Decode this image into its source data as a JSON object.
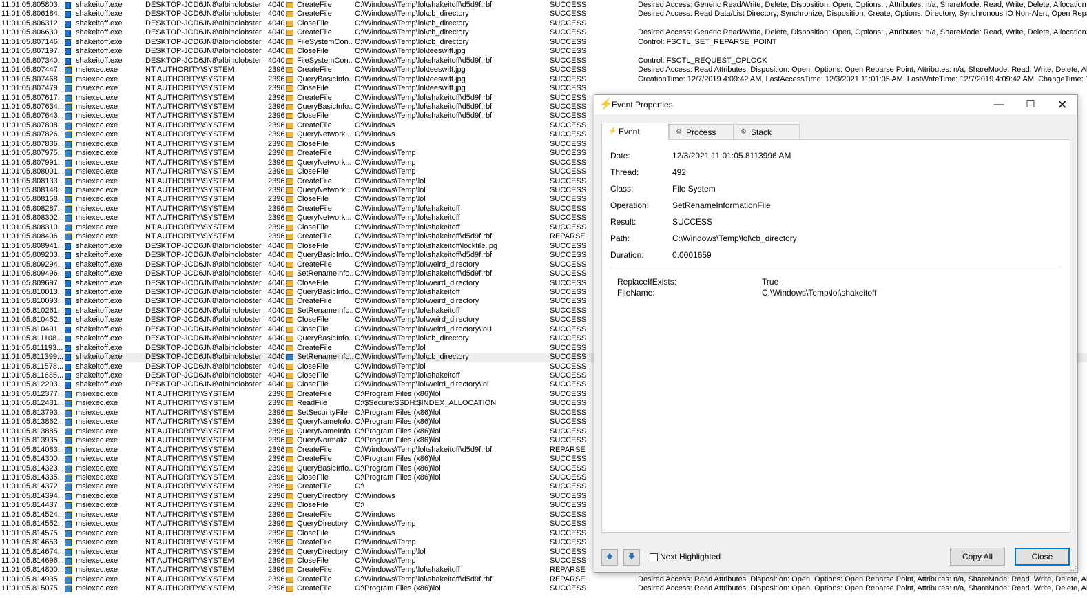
{
  "log_rows": [
    {
      "time": "11:01:05.805803...",
      "process": "shakeitoff.exe",
      "user": "DESKTOP-JCD6JN8\\albinolobster",
      "pid": "4040",
      "operation": "CreateFile",
      "path": "C:\\Windows\\Temp\\lol\\shakeitoff\\d5d9f.rbf",
      "result": "SUCCESS",
      "detail": "Desired Access: Generic Read/Write, Delete, Disposition: Open, Options: , Attributes: n/a, ShareMode: Read, Write, Delete, AllocationSize:"
    },
    {
      "time": "11:01:05.806184...",
      "process": "shakeitoff.exe",
      "user": "DESKTOP-JCD6JN8\\albinolobster",
      "pid": "4040",
      "operation": "CreateFile",
      "path": "C:\\Windows\\Temp\\lol\\cb_directory",
      "result": "SUCCESS",
      "detail": "Desired Access: Read Data/List Directory, Synchronize, Disposition: Create, Options: Directory, Synchronous IO Non-Alert, Open Reparse"
    },
    {
      "time": "11:01:05.806312...",
      "process": "shakeitoff.exe",
      "user": "DESKTOP-JCD6JN8\\albinolobster",
      "pid": "4040",
      "operation": "CloseFile",
      "path": "C:\\Windows\\Temp\\lol\\cb_directory",
      "result": "SUCCESS",
      "detail": ""
    },
    {
      "time": "11:01:05.806630...",
      "process": "shakeitoff.exe",
      "user": "DESKTOP-JCD6JN8\\albinolobster",
      "pid": "4040",
      "operation": "CreateFile",
      "path": "C:\\Windows\\Temp\\lol\\cb_directory",
      "result": "SUCCESS",
      "detail": "Desired Access: Generic Read/Write, Delete, Disposition: Open, Options: , Attributes: n/a, ShareMode: Read, Write, Delete, AllocationS"
    },
    {
      "time": "11:01:05.807146...",
      "process": "shakeitoff.exe",
      "user": "DESKTOP-JCD6JN8\\albinolobster",
      "pid": "4040",
      "operation": "FileSystemCon...",
      "path": "C:\\Windows\\Temp\\lol\\cb_directory",
      "result": "SUCCESS",
      "detail": "Control: FSCTL_SET_REPARSE_POINT"
    },
    {
      "time": "11:01:05.807197...",
      "process": "shakeitoff.exe",
      "user": "DESKTOP-JCD6JN8\\albinolobster",
      "pid": "4040",
      "operation": "CloseFile",
      "path": "C:\\Windows\\Temp\\lol\\teeswift.jpg",
      "result": "SUCCESS",
      "detail": ""
    },
    {
      "time": "11:01:05.807340...",
      "process": "shakeitoff.exe",
      "user": "DESKTOP-JCD6JN8\\albinolobster",
      "pid": "4040",
      "operation": "FileSystemCon...",
      "path": "C:\\Windows\\Temp\\lol\\shakeitoff\\d5d9f.rbf",
      "result": "SUCCESS",
      "detail": "Control: FSCTL_REQUEST_OPLOCK"
    },
    {
      "time": "11:01:05.807447...",
      "process": "msiexec.exe",
      "user": "NT AUTHORITY\\SYSTEM",
      "pid": "2396",
      "operation": "CreateFile",
      "path": "C:\\Windows\\Temp\\lol\\teeswift.jpg",
      "result": "SUCCESS",
      "detail": "Desired Access: Read Attributes, Disposition: Open, Options: Open Reparse Point, Attributes: n/a, ShareMode: Read, Write, Delete, Allo"
    },
    {
      "time": "11:01:05.807468...",
      "process": "msiexec.exe",
      "user": "NT AUTHORITY\\SYSTEM",
      "pid": "2396",
      "operation": "QueryBasicInfo...",
      "path": "C:\\Windows\\Temp\\lol\\teeswift.jpg",
      "result": "SUCCESS",
      "detail": "CreationTime: 12/7/2019 4:09:42 AM, LastAccessTime: 12/3/2021 11:01:05 AM, LastWriteTime: 12/7/2019 4:09:42 AM, ChangeTime: 1:"
    },
    {
      "time": "11:01:05.807479...",
      "process": "msiexec.exe",
      "user": "NT AUTHORITY\\SYSTEM",
      "pid": "2396",
      "operation": "CloseFile",
      "path": "C:\\Windows\\Temp\\lol\\teeswift.jpg",
      "result": "SUCCESS",
      "detail": ""
    },
    {
      "time": "11:01:05.807617...",
      "process": "msiexec.exe",
      "user": "NT AUTHORITY\\SYSTEM",
      "pid": "2396",
      "operation": "CreateFile",
      "path": "C:\\Windows\\Temp\\lol\\shakeitoff\\d5d9f.rbf",
      "result": "SUCCESS",
      "detail": ""
    },
    {
      "time": "11:01:05.807634...",
      "process": "msiexec.exe",
      "user": "NT AUTHORITY\\SYSTEM",
      "pid": "2396",
      "operation": "QueryBasicInfo...",
      "path": "C:\\Windows\\Temp\\lol\\shakeitoff\\d5d9f.rbf",
      "result": "SUCCESS",
      "detail": ""
    },
    {
      "time": "11:01:05.807643...",
      "process": "msiexec.exe",
      "user": "NT AUTHORITY\\SYSTEM",
      "pid": "2396",
      "operation": "CloseFile",
      "path": "C:\\Windows\\Temp\\lol\\shakeitoff\\d5d9f.rbf",
      "result": "SUCCESS",
      "detail": ""
    },
    {
      "time": "11:01:05.807808...",
      "process": "msiexec.exe",
      "user": "NT AUTHORITY\\SYSTEM",
      "pid": "2396",
      "operation": "CreateFile",
      "path": "C:\\Windows",
      "result": "SUCCESS",
      "detail": ""
    },
    {
      "time": "11:01:05.807826...",
      "process": "msiexec.exe",
      "user": "NT AUTHORITY\\SYSTEM",
      "pid": "2396",
      "operation": "QueryNetwork...",
      "path": "C:\\Windows",
      "result": "SUCCESS",
      "detail": ""
    },
    {
      "time": "11:01:05.807836...",
      "process": "msiexec.exe",
      "user": "NT AUTHORITY\\SYSTEM",
      "pid": "2396",
      "operation": "CloseFile",
      "path": "C:\\Windows",
      "result": "SUCCESS",
      "detail": ""
    },
    {
      "time": "11:01:05.807975...",
      "process": "msiexec.exe",
      "user": "NT AUTHORITY\\SYSTEM",
      "pid": "2396",
      "operation": "CreateFile",
      "path": "C:\\Windows\\Temp",
      "result": "SUCCESS",
      "detail": ""
    },
    {
      "time": "11:01:05.807991...",
      "process": "msiexec.exe",
      "user": "NT AUTHORITY\\SYSTEM",
      "pid": "2396",
      "operation": "QueryNetwork...",
      "path": "C:\\Windows\\Temp",
      "result": "SUCCESS",
      "detail": ""
    },
    {
      "time": "11:01:05.808001...",
      "process": "msiexec.exe",
      "user": "NT AUTHORITY\\SYSTEM",
      "pid": "2396",
      "operation": "CloseFile",
      "path": "C:\\Windows\\Temp",
      "result": "SUCCESS",
      "detail": ""
    },
    {
      "time": "11:01:05.808133...",
      "process": "msiexec.exe",
      "user": "NT AUTHORITY\\SYSTEM",
      "pid": "2396",
      "operation": "CreateFile",
      "path": "C:\\Windows\\Temp\\lol",
      "result": "SUCCESS",
      "detail": ""
    },
    {
      "time": "11:01:05.808148...",
      "process": "msiexec.exe",
      "user": "NT AUTHORITY\\SYSTEM",
      "pid": "2396",
      "operation": "QueryNetwork...",
      "path": "C:\\Windows\\Temp\\lol",
      "result": "SUCCESS",
      "detail": ""
    },
    {
      "time": "11:01:05.808158...",
      "process": "msiexec.exe",
      "user": "NT AUTHORITY\\SYSTEM",
      "pid": "2396",
      "operation": "CloseFile",
      "path": "C:\\Windows\\Temp\\lol",
      "result": "SUCCESS",
      "detail": ""
    },
    {
      "time": "11:01:05.808287...",
      "process": "msiexec.exe",
      "user": "NT AUTHORITY\\SYSTEM",
      "pid": "2396",
      "operation": "CreateFile",
      "path": "C:\\Windows\\Temp\\lol\\shakeitoff",
      "result": "SUCCESS",
      "detail": ""
    },
    {
      "time": "11:01:05.808302...",
      "process": "msiexec.exe",
      "user": "NT AUTHORITY\\SYSTEM",
      "pid": "2396",
      "operation": "QueryNetwork...",
      "path": "C:\\Windows\\Temp\\lol\\shakeitoff",
      "result": "SUCCESS",
      "detail": ""
    },
    {
      "time": "11:01:05.808310...",
      "process": "msiexec.exe",
      "user": "NT AUTHORITY\\SYSTEM",
      "pid": "2396",
      "operation": "CloseFile",
      "path": "C:\\Windows\\Temp\\lol\\shakeitoff",
      "result": "SUCCESS",
      "detail": ""
    },
    {
      "time": "11:01:05.808406...",
      "process": "msiexec.exe",
      "user": "NT AUTHORITY\\SYSTEM",
      "pid": "2396",
      "operation": "CreateFile",
      "path": "C:\\Windows\\Temp\\lol\\shakeitoff\\d5d9f.rbf",
      "result": "REPARSE",
      "detail": ""
    },
    {
      "time": "11:01:05.808941...",
      "process": "shakeitoff.exe",
      "user": "DESKTOP-JCD6JN8\\albinolobster",
      "pid": "4040",
      "operation": "CloseFile",
      "path": "C:\\Windows\\Temp\\lol\\shakeitoff\\lockfile.jpg",
      "result": "SUCCESS",
      "detail": ""
    },
    {
      "time": "11:01:05.809203...",
      "process": "shakeitoff.exe",
      "user": "DESKTOP-JCD6JN8\\albinolobster",
      "pid": "4040",
      "operation": "QueryBasicInfo...",
      "path": "C:\\Windows\\Temp\\lol\\shakeitoff\\d5d9f.rbf",
      "result": "SUCCESS",
      "detail": ""
    },
    {
      "time": "11:01:05.809294...",
      "process": "shakeitoff.exe",
      "user": "DESKTOP-JCD6JN8\\albinolobster",
      "pid": "4040",
      "operation": "CreateFile",
      "path": "C:\\Windows\\Temp\\lol\\weird_directory",
      "result": "SUCCESS",
      "detail": ""
    },
    {
      "time": "11:01:05.809496...",
      "process": "shakeitoff.exe",
      "user": "DESKTOP-JCD6JN8\\albinolobster",
      "pid": "4040",
      "operation": "SetRenameInfo...",
      "path": "C:\\Windows\\Temp\\lol\\shakeitoff\\d5d9f.rbf",
      "result": "SUCCESS",
      "detail": ""
    },
    {
      "time": "11:01:05.809697...",
      "process": "shakeitoff.exe",
      "user": "DESKTOP-JCD6JN8\\albinolobster",
      "pid": "4040",
      "operation": "CloseFile",
      "path": "C:\\Windows\\Temp\\lol\\weird_directory",
      "result": "SUCCESS",
      "detail": ""
    },
    {
      "time": "11:01:05.810013...",
      "process": "shakeitoff.exe",
      "user": "DESKTOP-JCD6JN8\\albinolobster",
      "pid": "4040",
      "operation": "QueryBasicInfo...",
      "path": "C:\\Windows\\Temp\\lol\\shakeitoff",
      "result": "SUCCESS",
      "detail": ""
    },
    {
      "time": "11:01:05.810093...",
      "process": "shakeitoff.exe",
      "user": "DESKTOP-JCD6JN8\\albinolobster",
      "pid": "4040",
      "operation": "CreateFile",
      "path": "C:\\Windows\\Temp\\lol\\weird_directory",
      "result": "SUCCESS",
      "detail": ""
    },
    {
      "time": "11:01:05.810261...",
      "process": "shakeitoff.exe",
      "user": "DESKTOP-JCD6JN8\\albinolobster",
      "pid": "4040",
      "operation": "SetRenameInfo...",
      "path": "C:\\Windows\\Temp\\lol\\shakeitoff",
      "result": "SUCCESS",
      "detail": ""
    },
    {
      "time": "11:01:05.810452...",
      "process": "shakeitoff.exe",
      "user": "DESKTOP-JCD6JN8\\albinolobster",
      "pid": "4040",
      "operation": "CloseFile",
      "path": "C:\\Windows\\Temp\\lol\\weird_directory",
      "result": "SUCCESS",
      "detail": ""
    },
    {
      "time": "11:01:05.810491...",
      "process": "shakeitoff.exe",
      "user": "DESKTOP-JCD6JN8\\albinolobster",
      "pid": "4040",
      "operation": "CloseFile",
      "path": "C:\\Windows\\Temp\\lol\\weird_directory\\lol1",
      "result": "SUCCESS",
      "detail": ""
    },
    {
      "time": "11:01:05.811108...",
      "process": "shakeitoff.exe",
      "user": "DESKTOP-JCD6JN8\\albinolobster",
      "pid": "4040",
      "operation": "QueryBasicInfo...",
      "path": "C:\\Windows\\Temp\\lol\\cb_directory",
      "result": "SUCCESS",
      "detail": ""
    },
    {
      "time": "11:01:05.811193...",
      "process": "shakeitoff.exe",
      "user": "DESKTOP-JCD6JN8\\albinolobster",
      "pid": "4040",
      "operation": "CreateFile",
      "path": "C:\\Windows\\Temp\\lol",
      "result": "SUCCESS",
      "detail": ""
    },
    {
      "time": "11:01:05.811399...",
      "process": "shakeitoff.exe",
      "user": "DESKTOP-JCD6JN8\\albinolobster",
      "pid": "4040",
      "operation": "SetRenameInfo...",
      "path": "C:\\Windows\\Temp\\lol\\cb_directory",
      "result": "SUCCESS",
      "detail": "",
      "selected": true
    },
    {
      "time": "11:01:05.811578...",
      "process": "shakeitoff.exe",
      "user": "DESKTOP-JCD6JN8\\albinolobster",
      "pid": "4040",
      "operation": "CloseFile",
      "path": "C:\\Windows\\Temp\\lol",
      "result": "SUCCESS",
      "detail": ""
    },
    {
      "time": "11:01:05.811635...",
      "process": "shakeitoff.exe",
      "user": "DESKTOP-JCD6JN8\\albinolobster",
      "pid": "4040",
      "operation": "CloseFile",
      "path": "C:\\Windows\\Temp\\lol\\shakeitoff",
      "result": "SUCCESS",
      "detail": ""
    },
    {
      "time": "11:01:05.812203...",
      "process": "shakeitoff.exe",
      "user": "DESKTOP-JCD6JN8\\albinolobster",
      "pid": "4040",
      "operation": "CloseFile",
      "path": "C:\\Windows\\Temp\\lol\\weird_directory\\lol",
      "result": "SUCCESS",
      "detail": ""
    },
    {
      "time": "11:01:05.812377...",
      "process": "msiexec.exe",
      "user": "NT AUTHORITY\\SYSTEM",
      "pid": "2396",
      "operation": "CreateFile",
      "path": "C:\\Program Files (x86)\\lol",
      "result": "SUCCESS",
      "detail": ""
    },
    {
      "time": "11:01:05.812431...",
      "process": "msiexec.exe",
      "user": "NT AUTHORITY\\SYSTEM",
      "pid": "2396",
      "operation": "ReadFile",
      "path": "C:\\$Secure:$SDH:$INDEX_ALLOCATION",
      "result": "SUCCESS",
      "detail": ""
    },
    {
      "time": "11:01:05.813793...",
      "process": "msiexec.exe",
      "user": "NT AUTHORITY\\SYSTEM",
      "pid": "2396",
      "operation": "SetSecurityFile",
      "path": "C:\\Program Files (x86)\\lol",
      "result": "SUCCESS",
      "detail": ""
    },
    {
      "time": "11:01:05.813862...",
      "process": "msiexec.exe",
      "user": "NT AUTHORITY\\SYSTEM",
      "pid": "2396",
      "operation": "QueryNameInfo...",
      "path": "C:\\Program Files (x86)\\lol",
      "result": "SUCCESS",
      "detail": ""
    },
    {
      "time": "11:01:05.813885...",
      "process": "msiexec.exe",
      "user": "NT AUTHORITY\\SYSTEM",
      "pid": "2396",
      "operation": "QueryNameInfo...",
      "path": "C:\\Program Files (x86)\\lol",
      "result": "SUCCESS",
      "detail": ""
    },
    {
      "time": "11:01:05.813935...",
      "process": "msiexec.exe",
      "user": "NT AUTHORITY\\SYSTEM",
      "pid": "2396",
      "operation": "QueryNormaliz...",
      "path": "C:\\Program Files (x86)\\lol",
      "result": "SUCCESS",
      "detail": ""
    },
    {
      "time": "11:01:05.814083...",
      "process": "msiexec.exe",
      "user": "NT AUTHORITY\\SYSTEM",
      "pid": "2396",
      "operation": "CreateFile",
      "path": "C:\\Windows\\Temp\\lol\\shakeitoff\\d5d9f.rbf",
      "result": "REPARSE",
      "detail": ""
    },
    {
      "time": "11:01:05.814300...",
      "process": "msiexec.exe",
      "user": "NT AUTHORITY\\SYSTEM",
      "pid": "2396",
      "operation": "CreateFile",
      "path": "C:\\Program Files (x86)\\lol",
      "result": "SUCCESS",
      "detail": ""
    },
    {
      "time": "11:01:05.814323...",
      "process": "msiexec.exe",
      "user": "NT AUTHORITY\\SYSTEM",
      "pid": "2396",
      "operation": "QueryBasicInfo...",
      "path": "C:\\Program Files (x86)\\lol",
      "result": "SUCCESS",
      "detail": ""
    },
    {
      "time": "11:01:05.814335...",
      "process": "msiexec.exe",
      "user": "NT AUTHORITY\\SYSTEM",
      "pid": "2396",
      "operation": "CloseFile",
      "path": "C:\\Program Files (x86)\\lol",
      "result": "SUCCESS",
      "detail": ""
    },
    {
      "time": "11:01:05.814372...",
      "process": "msiexec.exe",
      "user": "NT AUTHORITY\\SYSTEM",
      "pid": "2396",
      "operation": "CreateFile",
      "path": "C:\\",
      "result": "SUCCESS",
      "detail": ""
    },
    {
      "time": "11:01:05.814394...",
      "process": "msiexec.exe",
      "user": "NT AUTHORITY\\SYSTEM",
      "pid": "2396",
      "operation": "QueryDirectory",
      "path": "C:\\Windows",
      "result": "SUCCESS",
      "detail": ""
    },
    {
      "time": "11:01:05.814437...",
      "process": "msiexec.exe",
      "user": "NT AUTHORITY\\SYSTEM",
      "pid": "2396",
      "operation": "CloseFile",
      "path": "C:\\",
      "result": "SUCCESS",
      "detail": ""
    },
    {
      "time": "11:01:05.814524...",
      "process": "msiexec.exe",
      "user": "NT AUTHORITY\\SYSTEM",
      "pid": "2396",
      "operation": "CreateFile",
      "path": "C:\\Windows",
      "result": "SUCCESS",
      "detail": ""
    },
    {
      "time": "11:01:05.814552...",
      "process": "msiexec.exe",
      "user": "NT AUTHORITY\\SYSTEM",
      "pid": "2396",
      "operation": "QueryDirectory",
      "path": "C:\\Windows\\Temp",
      "result": "SUCCESS",
      "detail": ""
    },
    {
      "time": "11:01:05.814575...",
      "process": "msiexec.exe",
      "user": "NT AUTHORITY\\SYSTEM",
      "pid": "2396",
      "operation": "CloseFile",
      "path": "C:\\Windows",
      "result": "SUCCESS",
      "detail": ""
    },
    {
      "time": "11:01:05.814653...",
      "process": "msiexec.exe",
      "user": "NT AUTHORITY\\SYSTEM",
      "pid": "2396",
      "operation": "CreateFile",
      "path": "C:\\Windows\\Temp",
      "result": "SUCCESS",
      "detail": ""
    },
    {
      "time": "11:01:05.814674...",
      "process": "msiexec.exe",
      "user": "NT AUTHORITY\\SYSTEM",
      "pid": "2396",
      "operation": "QueryDirectory",
      "path": "C:\\Windows\\Temp\\lol",
      "result": "SUCCESS",
      "detail": ""
    },
    {
      "time": "11:01:05.814696...",
      "process": "msiexec.exe",
      "user": "NT AUTHORITY\\SYSTEM",
      "pid": "2396",
      "operation": "CloseFile",
      "path": "C:\\Windows\\Temp",
      "result": "SUCCESS",
      "detail": ""
    },
    {
      "time": "11:01:05.814800...",
      "process": "msiexec.exe",
      "user": "NT AUTHORITY\\SYSTEM",
      "pid": "2396",
      "operation": "CreateFile",
      "path": "C:\\Windows\\Temp\\lol\\shakeitoff",
      "result": "REPARSE",
      "detail": ""
    },
    {
      "time": "11:01:05.814935...",
      "process": "msiexec.exe",
      "user": "NT AUTHORITY\\SYSTEM",
      "pid": "2396",
      "operation": "CreateFile",
      "path": "C:\\Windows\\Temp\\lol\\shakeitoff\\d5d9f.rbf",
      "result": "REPARSE",
      "detail": "Desired Access: Read Attributes, Disposition: Open, Options: Open Reparse Point, Attributes: n/a, ShareMode: Read, Write, Delete, Allo"
    },
    {
      "time": "11:01:05.815075...",
      "process": "msiexec.exe",
      "user": "NT AUTHORITY\\SYSTEM",
      "pid": "2396",
      "operation": "CreateFile",
      "path": "C:\\Program Files (x86)\\lol",
      "result": "SUCCESS",
      "detail": "Desired Access: Read Attributes, Disposition: Open, Options: Open Reparse Point, Attributes: n/a, ShareMode: Read, Write, Delete, Allo"
    }
  ],
  "dialog": {
    "title": "Event Properties",
    "min_glyph": "—",
    "max_glyph": "☐",
    "close_glyph": "✕",
    "tabs": [
      {
        "label": "Event",
        "icon": "⚡"
      },
      {
        "label": "Process",
        "icon": "⚙"
      },
      {
        "label": "Stack",
        "icon": "⚙"
      }
    ],
    "fields": [
      {
        "label": "Date:",
        "value": "12/3/2021 11:01:05.8113996 AM"
      },
      {
        "label": "Thread:",
        "value": "492"
      },
      {
        "label": "Class:",
        "value": "File System"
      },
      {
        "label": "Operation:",
        "value": "SetRenameInformationFile"
      },
      {
        "label": "Result:",
        "value": "SUCCESS"
      },
      {
        "label": "Path:",
        "value": "C:\\Windows\\Temp\\lol\\cb_directory"
      },
      {
        "label": "Duration:",
        "value": "0.0001659"
      }
    ],
    "details": [
      {
        "label": "ReplaceIfExists:",
        "value": "True"
      },
      {
        "label": "FileName:",
        "value": "C:\\Windows\\Temp\\lol\\shakeitoff"
      }
    ],
    "up_glyph": "🡅",
    "down_glyph": "🡇",
    "next_highlighted_label": "Next Highlighted",
    "copy_all_label": "Copy All",
    "close_label": "Close"
  }
}
